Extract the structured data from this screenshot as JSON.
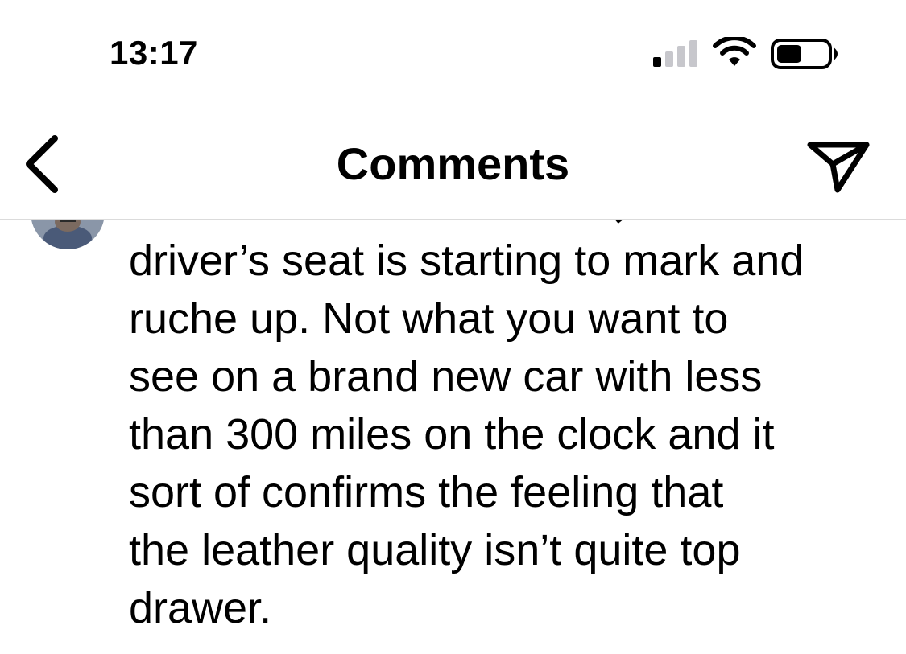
{
  "status_bar": {
    "time": "13:17",
    "signal_icon": "cellular-signal-icon",
    "wifi_icon": "wifi-icon",
    "battery_icon": "battery-icon"
  },
  "header": {
    "title": "Comments",
    "back_icon": "chevron-left-icon",
    "send_icon": "paper-plane-icon"
  },
  "comment": {
    "avatar_icon": "avatar",
    "text": "driver’s seat is starting to mark and\nruche up. Not what you want to\nsee on a brand new car with less\nthan 300 miles on the clock and it\nsort of confirms the feeling that\nthe leather quality isn’t quite top\ndrawer."
  },
  "colors": {
    "text": "#000000",
    "divider": "#dbdbdb",
    "link": "#385185"
  }
}
